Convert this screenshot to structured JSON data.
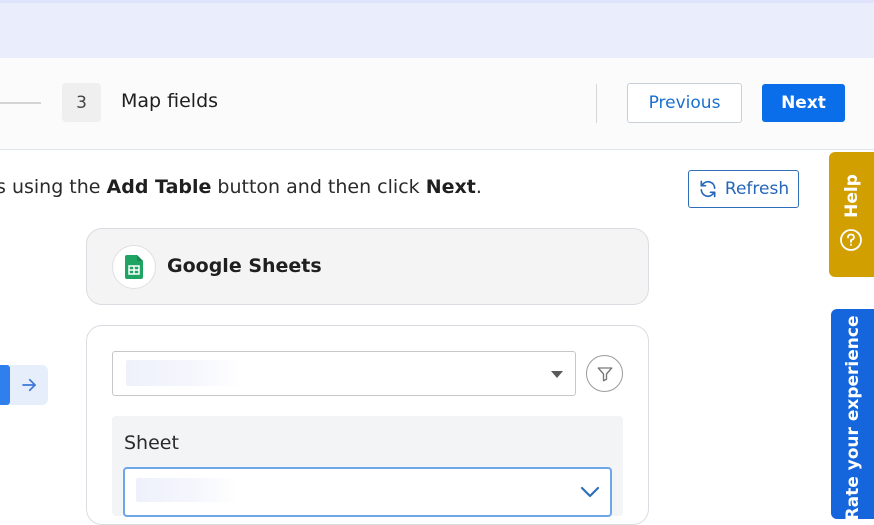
{
  "stepper": {
    "current_step_number": "3",
    "current_step_label": "Map fields",
    "previous_label": "Previous",
    "next_label": "Next"
  },
  "instruction": {
    "lead": "s using the ",
    "bold1": "Add Table",
    "mid": " button and then click ",
    "bold2": "Next",
    "end": "."
  },
  "refresh_label": "Refresh",
  "source": {
    "name": "Google Sheets",
    "icon": "google-sheets-icon"
  },
  "sheet_label": "Sheet",
  "side_tabs": {
    "help_label": "Help",
    "rate_label": "Rate your experience"
  },
  "colors": {
    "primary": "#0a6de9",
    "help_tab": "#d29f00",
    "rate_tab": "#1565dc",
    "sheets_green": "#1fa463"
  }
}
